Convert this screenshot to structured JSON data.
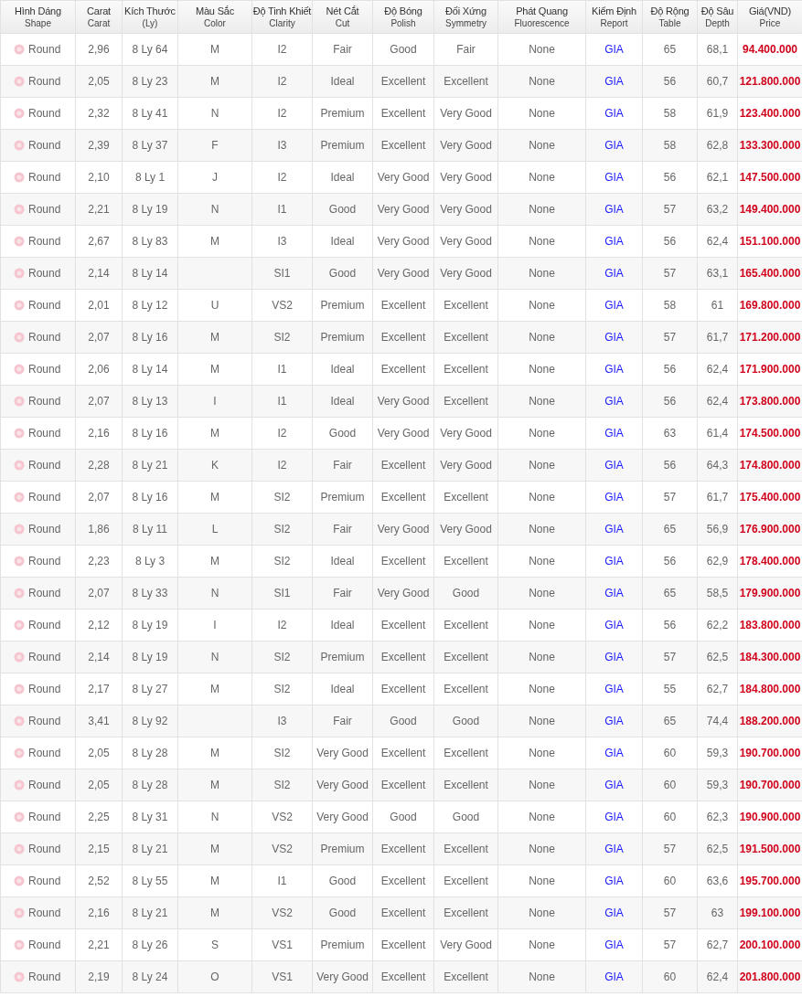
{
  "table": {
    "columns": [
      {
        "title": "Hình Dáng",
        "subtitle": "Shape"
      },
      {
        "title": "Carat",
        "subtitle": "Carat"
      },
      {
        "title": "Kích Thước",
        "subtitle": "(Ly)"
      },
      {
        "title": "Màu Sắc",
        "subtitle": "Color"
      },
      {
        "title": "Độ Tinh Khiết",
        "subtitle": "Clarity"
      },
      {
        "title": "Nét Cắt",
        "subtitle": "Cut"
      },
      {
        "title": "Độ Bóng",
        "subtitle": "Polish"
      },
      {
        "title": "Đối Xứng",
        "subtitle": "Symmetry"
      },
      {
        "title": "Phát Quang",
        "subtitle": "Fluorescence"
      },
      {
        "title": "Kiểm Định",
        "subtitle": "Report"
      },
      {
        "title": "Độ Rộng",
        "subtitle": "Table"
      },
      {
        "title": "Độ Sâu",
        "subtitle": "Depth"
      },
      {
        "title": "Giá(VND)",
        "subtitle": "Price"
      }
    ],
    "rows": [
      {
        "shape": "Round",
        "carat": "2,96",
        "size": "8 Ly 64",
        "color_grade": "M",
        "clarity": "I2",
        "cut": "Fair",
        "polish": "Good",
        "symmetry": "Fair",
        "fluorescence": "None",
        "report": "GIA",
        "table": "65",
        "depth": "68,1",
        "price": "94.400.000"
      },
      {
        "shape": "Round",
        "carat": "2,05",
        "size": "8 Ly 23",
        "color_grade": "M",
        "clarity": "I2",
        "cut": "Ideal",
        "polish": "Excellent",
        "symmetry": "Excellent",
        "fluorescence": "None",
        "report": "GIA",
        "table": "56",
        "depth": "60,7",
        "price": "121.800.000"
      },
      {
        "shape": "Round",
        "carat": "2,32",
        "size": "8 Ly 41",
        "color_grade": "N",
        "clarity": "I2",
        "cut": "Premium",
        "polish": "Excellent",
        "symmetry": "Very Good",
        "fluorescence": "None",
        "report": "GIA",
        "table": "58",
        "depth": "61,9",
        "price": "123.400.000"
      },
      {
        "shape": "Round",
        "carat": "2,39",
        "size": "8 Ly 37",
        "color_grade": "F",
        "clarity": "I3",
        "cut": "Premium",
        "polish": "Excellent",
        "symmetry": "Very Good",
        "fluorescence": "None",
        "report": "GIA",
        "table": "58",
        "depth": "62,8",
        "price": "133.300.000"
      },
      {
        "shape": "Round",
        "carat": "2,10",
        "size": "8 Ly 1",
        "color_grade": "J",
        "clarity": "I2",
        "cut": "Ideal",
        "polish": "Very Good",
        "symmetry": "Very Good",
        "fluorescence": "None",
        "report": "GIA",
        "table": "56",
        "depth": "62,1",
        "price": "147.500.000"
      },
      {
        "shape": "Round",
        "carat": "2,21",
        "size": "8 Ly 19",
        "color_grade": "N",
        "clarity": "I1",
        "cut": "Good",
        "polish": "Very Good",
        "symmetry": "Very Good",
        "fluorescence": "None",
        "report": "GIA",
        "table": "57",
        "depth": "63,2",
        "price": "149.400.000"
      },
      {
        "shape": "Round",
        "carat": "2,67",
        "size": "8 Ly 83",
        "color_grade": "M",
        "clarity": "I3",
        "cut": "Ideal",
        "polish": "Very Good",
        "symmetry": "Very Good",
        "fluorescence": "None",
        "report": "GIA",
        "table": "56",
        "depth": "62,4",
        "price": "151.100.000"
      },
      {
        "shape": "Round",
        "carat": "2,14",
        "size": "8 Ly 14",
        "clarity": "SI1",
        "cut": "Good",
        "polish": "Very Good",
        "symmetry": "Very Good",
        "fluorescence": "None",
        "report": "GIA",
        "table": "57",
        "depth": "63,1",
        "price": "165.400.000"
      },
      {
        "shape": "Round",
        "carat": "2,01",
        "size": "8 Ly 12",
        "color_grade": "U",
        "clarity": "VS2",
        "cut": "Premium",
        "polish": "Excellent",
        "symmetry": "Excellent",
        "fluorescence": "None",
        "report": "GIA",
        "table": "58",
        "depth": "61",
        "price": "169.800.000"
      },
      {
        "shape": "Round",
        "carat": "2,07",
        "size": "8 Ly 16",
        "color_grade": "M",
        "clarity": "SI2",
        "cut": "Premium",
        "polish": "Excellent",
        "symmetry": "Excellent",
        "fluorescence": "None",
        "report": "GIA",
        "table": "57",
        "depth": "61,7",
        "price": "171.200.000"
      },
      {
        "shape": "Round",
        "carat": "2,06",
        "size": "8 Ly 14",
        "color_grade": "M",
        "clarity": "I1",
        "cut": "Ideal",
        "polish": "Excellent",
        "symmetry": "Excellent",
        "fluorescence": "None",
        "report": "GIA",
        "table": "56",
        "depth": "62,4",
        "price": "171.900.000"
      },
      {
        "shape": "Round",
        "carat": "2,07",
        "size": "8 Ly 13",
        "color_grade": "I",
        "clarity": "I1",
        "cut": "Ideal",
        "polish": "Very Good",
        "symmetry": "Excellent",
        "fluorescence": "None",
        "report": "GIA",
        "table": "56",
        "depth": "62,4",
        "price": "173.800.000"
      },
      {
        "shape": "Round",
        "carat": "2,16",
        "size": "8 Ly 16",
        "color_grade": "M",
        "clarity": "I2",
        "cut": "Good",
        "polish": "Very Good",
        "symmetry": "Very Good",
        "fluorescence": "None",
        "report": "GIA",
        "table": "63",
        "depth": "61,4",
        "price": "174.500.000"
      },
      {
        "shape": "Round",
        "carat": "2,28",
        "size": "8 Ly 21",
        "color_grade": "K",
        "clarity": "I2",
        "cut": "Fair",
        "polish": "Excellent",
        "symmetry": "Very Good",
        "fluorescence": "None",
        "report": "GIA",
        "table": "56",
        "depth": "64,3",
        "price": "174.800.000"
      },
      {
        "shape": "Round",
        "carat": "2,07",
        "size": "8 Ly 16",
        "color_grade": "M",
        "clarity": "SI2",
        "cut": "Premium",
        "polish": "Excellent",
        "symmetry": "Excellent",
        "fluorescence": "None",
        "report": "GIA",
        "table": "57",
        "depth": "61,7",
        "price": "175.400.000"
      },
      {
        "shape": "Round",
        "carat": "1,86",
        "size": "8 Ly 11",
        "color_grade": "L",
        "clarity": "SI2",
        "cut": "Fair",
        "polish": "Very Good",
        "symmetry": "Very Good",
        "fluorescence": "None",
        "report": "GIA",
        "table": "65",
        "depth": "56,9",
        "price": "176.900.000"
      },
      {
        "shape": "Round",
        "carat": "2,23",
        "size": "8 Ly 3",
        "color_grade": "M",
        "clarity": "SI2",
        "cut": "Ideal",
        "polish": "Excellent",
        "symmetry": "Excellent",
        "fluorescence": "None",
        "report": "GIA",
        "table": "56",
        "depth": "62,9",
        "price": "178.400.000"
      },
      {
        "shape": "Round",
        "carat": "2,07",
        "size": "8 Ly 33",
        "color_grade": "N",
        "clarity": "SI1",
        "cut": "Fair",
        "polish": "Very Good",
        "symmetry": "Good",
        "fluorescence": "None",
        "report": "GIA",
        "table": "65",
        "depth": "58,5",
        "price": "179.900.000"
      },
      {
        "shape": "Round",
        "carat": "2,12",
        "size": "8 Ly 19",
        "color_grade": "I",
        "clarity": "I2",
        "cut": "Ideal",
        "polish": "Excellent",
        "symmetry": "Excellent",
        "fluorescence": "None",
        "report": "GIA",
        "table": "56",
        "depth": "62,2",
        "price": "183.800.000"
      },
      {
        "shape": "Round",
        "carat": "2,14",
        "size": "8 Ly 19",
        "color_grade": "N",
        "clarity": "SI2",
        "cut": "Premium",
        "polish": "Excellent",
        "symmetry": "Excellent",
        "fluorescence": "None",
        "report": "GIA",
        "table": "57",
        "depth": "62,5",
        "price": "184.300.000"
      },
      {
        "shape": "Round",
        "carat": "2,17",
        "size": "8 Ly 27",
        "color_grade": "M",
        "clarity": "SI2",
        "cut": "Ideal",
        "polish": "Excellent",
        "symmetry": "Excellent",
        "fluorescence": "None",
        "report": "GIA",
        "table": "55",
        "depth": "62,7",
        "price": "184.800.000"
      },
      {
        "shape": "Round",
        "carat": "3,41",
        "size": "8 Ly 92",
        "clarity": "I3",
        "cut": "Fair",
        "polish": "Good",
        "symmetry": "Good",
        "fluorescence": "None",
        "report": "GIA",
        "table": "65",
        "depth": "74,4",
        "price": "188.200.000"
      },
      {
        "shape": "Round",
        "carat": "2,05",
        "size": "8 Ly 28",
        "color_grade": "M",
        "clarity": "SI2",
        "cut": "Very Good",
        "polish": "Excellent",
        "symmetry": "Excellent",
        "fluorescence": "None",
        "report": "GIA",
        "table": "60",
        "depth": "59,3",
        "price": "190.700.000"
      },
      {
        "shape": "Round",
        "carat": "2,05",
        "size": "8 Ly 28",
        "color_grade": "M",
        "clarity": "SI2",
        "cut": "Very Good",
        "polish": "Excellent",
        "symmetry": "Excellent",
        "fluorescence": "None",
        "report": "GIA",
        "table": "60",
        "depth": "59,3",
        "price": "190.700.000"
      },
      {
        "shape": "Round",
        "carat": "2,25",
        "size": "8 Ly 31",
        "color_grade": "N",
        "clarity": "VS2",
        "cut": "Very Good",
        "polish": "Good",
        "symmetry": "Good",
        "fluorescence": "None",
        "report": "GIA",
        "table": "60",
        "depth": "62,3",
        "price": "190.900.000"
      },
      {
        "shape": "Round",
        "carat": "2,15",
        "size": "8 Ly 21",
        "color_grade": "M",
        "clarity": "VS2",
        "cut": "Premium",
        "polish": "Excellent",
        "symmetry": "Excellent",
        "fluorescence": "None",
        "report": "GIA",
        "table": "57",
        "depth": "62,5",
        "price": "191.500.000"
      },
      {
        "shape": "Round",
        "carat": "2,52",
        "size": "8 Ly 55",
        "color_grade": "M",
        "clarity": "I1",
        "cut": "Good",
        "polish": "Excellent",
        "symmetry": "Excellent",
        "fluorescence": "None",
        "report": "GIA",
        "table": "60",
        "depth": "63,6",
        "price": "195.700.000"
      },
      {
        "shape": "Round",
        "carat": "2,16",
        "size": "8 Ly 21",
        "color_grade": "M",
        "clarity": "VS2",
        "cut": "Good",
        "polish": "Excellent",
        "symmetry": "Excellent",
        "fluorescence": "None",
        "report": "GIA",
        "table": "57",
        "depth": "63",
        "price": "199.100.000"
      },
      {
        "shape": "Round",
        "carat": "2,21",
        "size": "8 Ly 26",
        "color_grade": "S",
        "clarity": "VS1",
        "cut": "Premium",
        "polish": "Excellent",
        "symmetry": "Very Good",
        "fluorescence": "None",
        "report": "GIA",
        "table": "57",
        "depth": "62,7",
        "price": "200.100.000"
      },
      {
        "shape": "Round",
        "carat": "2,19",
        "size": "8 Ly 24",
        "color_grade": "O",
        "clarity": "VS1",
        "cut": "Very Good",
        "polish": "Excellent",
        "symmetry": "Excellent",
        "fluorescence": "None",
        "report": "GIA",
        "table": "60",
        "depth": "62,4",
        "price": "201.800.000"
      }
    ]
  }
}
